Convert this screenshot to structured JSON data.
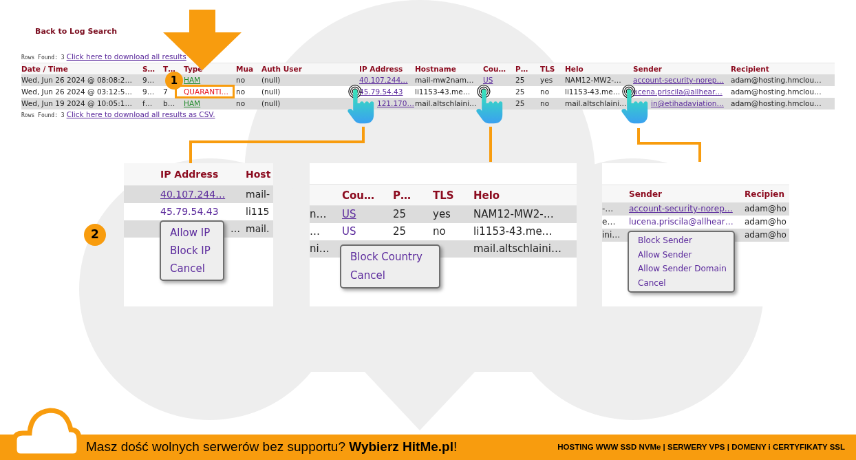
{
  "back_link": "Back to Log Search",
  "rows_found_top": {
    "label": "Rows Found: 3",
    "link": "Click here to download all results"
  },
  "table": {
    "columns": [
      "Date / Time",
      "S…",
      "T…",
      "Type",
      "Mua",
      "Auth User",
      "IP Address",
      "Hostname",
      "Cou…",
      "P…",
      "TLS",
      "Helo",
      "Sender",
      "Recipient"
    ],
    "rows": [
      {
        "cells": [
          {
            "text": "Wed, Jun 26 2024 @ 08:08:2…",
            "kind": "plain"
          },
          {
            "text": "9…",
            "kind": "plain"
          },
          null,
          {
            "text": "HAM",
            "kind": "ham"
          },
          {
            "text": "no",
            "kind": "plain"
          },
          {
            "text": "(null)",
            "kind": "plain"
          },
          {
            "text": "40.107.244…",
            "kind": "link"
          },
          {
            "text": "mail-mw2nam…",
            "kind": "plain"
          },
          {
            "text": "US",
            "kind": "link"
          },
          {
            "text": "25",
            "kind": "plain"
          },
          {
            "text": "yes",
            "kind": "plain"
          },
          {
            "text": "NAM12-MW2-…",
            "kind": "plain"
          },
          {
            "text": "account-security-norep…",
            "kind": "link"
          },
          {
            "text": "adam@hosting.hmclou…",
            "kind": "plain"
          }
        ]
      },
      {
        "cells": [
          {
            "text": "Wed, Jun 26 2024 @ 03:12:5…",
            "kind": "plain"
          },
          {
            "text": "9…",
            "kind": "plain"
          },
          {
            "text": "7",
            "kind": "plain"
          },
          {
            "text": "QUARANTI…",
            "kind": "quarantine"
          },
          {
            "text": "no",
            "kind": "plain"
          },
          {
            "text": "(null)",
            "kind": "plain"
          },
          {
            "text": "45.79.54.43",
            "kind": "link"
          },
          {
            "text": "li1153-43.me…",
            "kind": "plain"
          },
          null,
          {
            "text": "25",
            "kind": "plain"
          },
          {
            "text": "no",
            "kind": "plain"
          },
          {
            "text": "li1153-43.me…",
            "kind": "plain"
          },
          {
            "text": "ucena.priscila@allhear…",
            "kind": "link"
          },
          {
            "text": "adam@hosting.hmclou…",
            "kind": "plain"
          }
        ]
      },
      {
        "cells": [
          {
            "text": "Wed, Jun 19 2024 @ 10:05:1…",
            "kind": "plain"
          },
          {
            "text": "f…",
            "kind": "plain"
          },
          {
            "text": "b…",
            "kind": "plain"
          },
          {
            "text": "HAM",
            "kind": "ham"
          },
          {
            "text": "no",
            "kind": "plain"
          },
          {
            "text": "(null)",
            "kind": "plain"
          },
          {
            "text": "121.170…",
            "kind": "link_offset"
          },
          {
            "text": "mail.altschlaini…",
            "kind": "plain"
          },
          null,
          {
            "text": "25",
            "kind": "plain"
          },
          {
            "text": "no",
            "kind": "plain"
          },
          {
            "text": "mail.altschlaini…",
            "kind": "plain"
          },
          {
            "text": "in@etihadaviation…",
            "kind": "link_offset"
          },
          {
            "text": "adam@hosting.hmclou…",
            "kind": "plain"
          }
        ]
      }
    ]
  },
  "rows_found_bottom": {
    "label": "Rows Found: 3",
    "link": "Click here to download all results as CSV."
  },
  "step_badges": [
    "1",
    "2"
  ],
  "panels": [
    {
      "columns": [
        null,
        "IP Address",
        "Host"
      ],
      "rows": [
        {
          "cells": [
            null,
            {
              "text": "40.107.244…",
              "kind": "link"
            },
            {
              "text": "mail-",
              "kind": "plain"
            }
          ]
        },
        {
          "cells": [
            null,
            {
              "text": "45.79.54.43",
              "kind": "link_plain"
            },
            {
              "text": "li115",
              "kind": "plain"
            }
          ]
        },
        {
          "cells": [
            null,
            {
              "text": "…",
              "kind": "trailing"
            },
            {
              "text": "mail.",
              "kind": "plain"
            }
          ]
        }
      ],
      "menu": [
        "Allow IP",
        "Block IP",
        "Cancel"
      ]
    },
    {
      "columns": [
        null,
        "Cou…",
        "P…",
        "TLS",
        "Helo"
      ],
      "rows": [
        {
          "cells": [
            {
              "text": "n…",
              "kind": "plain"
            },
            {
              "text": "US",
              "kind": "link"
            },
            {
              "text": "25",
              "kind": "plain"
            },
            {
              "text": "yes",
              "kind": "plain"
            },
            {
              "text": "NAM12-MW2-…",
              "kind": "plain"
            }
          ]
        },
        {
          "cells": [
            {
              "text": "…",
              "kind": "plain"
            },
            {
              "text": "US",
              "kind": "link_plain"
            },
            {
              "text": "25",
              "kind": "plain"
            },
            {
              "text": "no",
              "kind": "plain"
            },
            {
              "text": "li1153-43.me…",
              "kind": "plain"
            }
          ]
        },
        {
          "cells": [
            {
              "text": "ni…",
              "kind": "plain"
            },
            null,
            null,
            null,
            {
              "text": "mail.altschlaini…",
              "kind": "plain"
            }
          ]
        }
      ],
      "menu": [
        "Block Country",
        "Cancel"
      ]
    },
    {
      "columns": [
        null,
        "Sender",
        "Recipien"
      ],
      "rows": [
        {
          "cells": [
            {
              "text": "-…",
              "kind": "plain"
            },
            {
              "text": "account-security-norep…",
              "kind": "link"
            },
            {
              "text": "adam@ho",
              "kind": "plain"
            }
          ]
        },
        {
          "cells": [
            {
              "text": "e…",
              "kind": "plain"
            },
            {
              "text": "lucena.priscila@allhear…",
              "kind": "link_plain"
            },
            {
              "text": "adam@ho",
              "kind": "plain"
            }
          ]
        },
        {
          "cells": [
            {
              "text": "ini…",
              "kind": "plain"
            },
            null,
            {
              "text": "adam@ho",
              "kind": "plain"
            }
          ]
        }
      ],
      "menu": [
        "Block Sender",
        "Allow Sender",
        "Allow Sender Domain",
        "Cancel"
      ]
    }
  ],
  "footer": {
    "slogan": "Masz dość wolnych serwerów bez supportu? **Wybierz HitMe.pl**!",
    "services": "HOSTING WWW SSD NVMe | SERWERY VPS | DOMENY i CERTYFIKATY SSL"
  }
}
